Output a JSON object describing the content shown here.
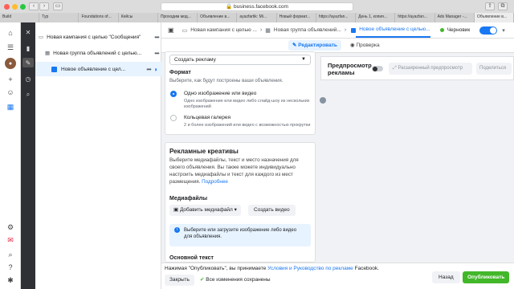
{
  "browser": {
    "url": "business.facebook.com",
    "tabs": [
      "Build",
      "Typ",
      "Foundations of...",
      "Кейсы",
      "Проходим мод...",
      "Объявление в...",
      "ayazfartik: Mi...",
      "Новый формат...",
      "https://ayazfan...",
      "День 1, копия...",
      "https://ayazfan...",
      "Ads Manager -...",
      "Объявление в..."
    ]
  },
  "tree": {
    "campaign": "Новая кампания с целью \"Сообщения\"",
    "adset": "Новая группа объявлений с целью...",
    "ad": "Новое объявление с цел..."
  },
  "breadcrumbs": [
    "Новая кампания с целью ...",
    "Новая группа объявлений...",
    "Новое объявление с целью..."
  ],
  "status": "Черновик",
  "actions": {
    "edit": "Редактировать",
    "review": "Проверка"
  },
  "form": {
    "create_ad_select": "Создать рекламу",
    "format_title": "Формат",
    "format_sub": "Выберите, как будут построены ваши объявления.",
    "options": [
      {
        "title": "Одно изображение или видео",
        "desc": "Одно изображение или видео либо слайд-шоу из нескольких изображений"
      },
      {
        "title": "Кольцевая галерея",
        "desc": "2 и более изображений или видео с возможностью прокрутки"
      }
    ],
    "creatives_title": "Рекламные креативы",
    "creatives_text": "Выберите медиафайлы, текст и место назначения для своего объявления. Вы также можете индивидуально настроить медиафайлы и текст для каждого из мест размещения.",
    "more_link": "Подробнее",
    "media_title": "Медиафайлы",
    "add_media": "Добавить медиафайл",
    "create_video": "Создать видео",
    "info": "Выберите или загрузите изображение либо видео для объявления.",
    "main_text": "Основной текст"
  },
  "preview": {
    "title": "Предпросмотр рекламы",
    "advanced": "Расширенный предпросмотр",
    "share": "Поделиться"
  },
  "footer": {
    "terms_prefix": "Нажимая \"Опубликовать\", вы принимаете",
    "terms_link": "Условия и Руководство по рекламе",
    "terms_suffix": "Facebook.",
    "close": "Закрыть",
    "saved": "Все изменения сохранены",
    "back": "Назад",
    "publish": "Опубликовать"
  },
  "colors": {
    "accent": "#1877f2",
    "publish": "#42b72a",
    "dark_rail": "#2f3035"
  }
}
